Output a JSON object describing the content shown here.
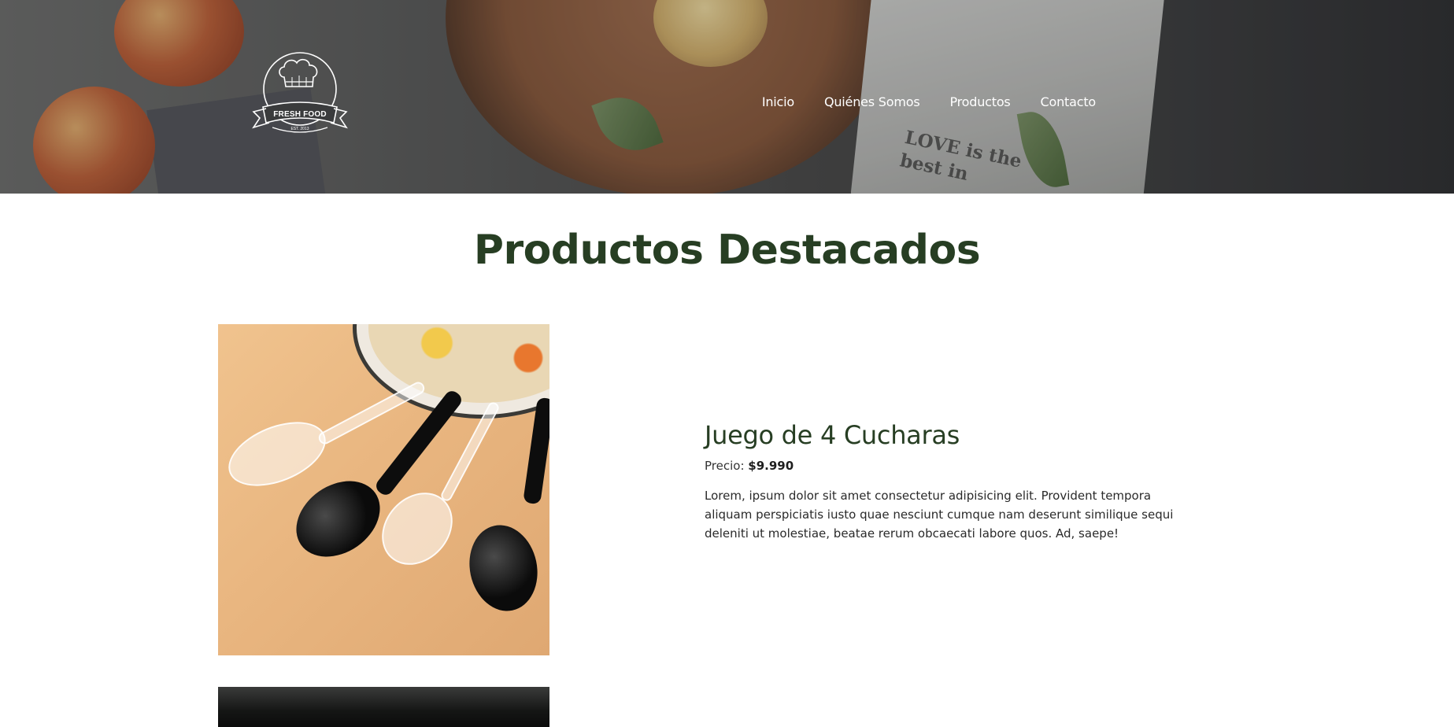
{
  "header": {
    "logo": {
      "icon": "chef-hat-icon",
      "brand_text": "FRESH FOOD",
      "est_text": "EST. 2013"
    },
    "nav": [
      {
        "label": "Inicio"
      },
      {
        "label": "Quiénes Somos"
      },
      {
        "label": "Productos"
      },
      {
        "label": "Contacto"
      }
    ],
    "hero_print_text": [
      "LOVE is the",
      "best in"
    ]
  },
  "main": {
    "section_title": "Productos Destacados",
    "products": [
      {
        "name": "Juego de 4 Cucharas",
        "price_label": "Precio:",
        "price_value": "$9.990",
        "description": "Lorem, ipsum dolor sit amet consectetur adipisicing elit. Provident tempora aliquam perspiciatis iusto quae nesciunt cumque nam deserunt similique sequi deleniti ut molestiae, beatae rerum obcaecati labore quos. Ad, saepe!",
        "image": "spoons-product-image"
      },
      {
        "image": "dark-product-image"
      }
    ]
  },
  "colors": {
    "title_green": "#273e23",
    "nav_text": "#ffffff",
    "background": "#ffffff"
  }
}
